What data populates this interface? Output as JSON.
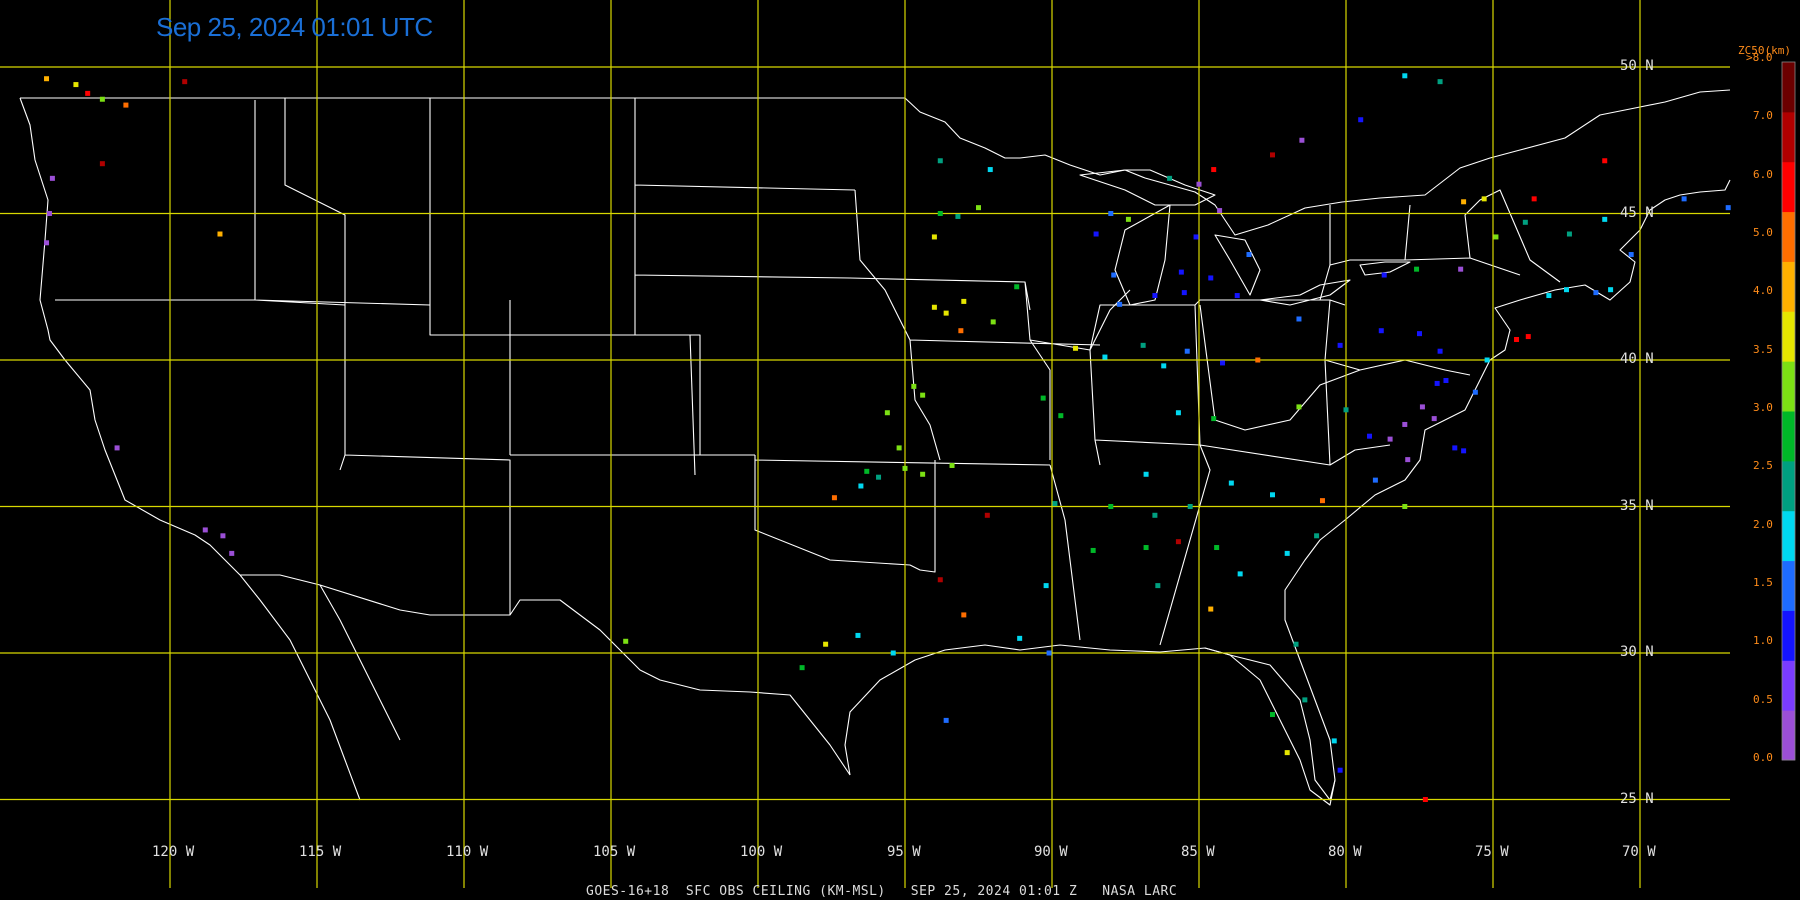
{
  "header": {
    "timestamp": "Sep 25, 2024 01:01 UTC"
  },
  "footer": {
    "caption": "GOES-16+18  SFC OBS CEILING (KM-MSL)   SEP 25, 2024 01:01 Z   NASA LARC"
  },
  "latitudes": [
    {
      "label": "50 N",
      "value": 50
    },
    {
      "label": "45 N",
      "value": 45
    },
    {
      "label": "40 N",
      "value": 40
    },
    {
      "label": "35 N",
      "value": 35
    },
    {
      "label": "30 N",
      "value": 30
    },
    {
      "label": "25 N",
      "value": 25
    }
  ],
  "longitudes": [
    {
      "label": "120 W",
      "value": -120
    },
    {
      "label": "115 W",
      "value": -115
    },
    {
      "label": "110 W",
      "value": -110
    },
    {
      "label": "105 W",
      "value": -105
    },
    {
      "label": "100 W",
      "value": -100
    },
    {
      "label": "95 W",
      "value": -95
    },
    {
      "label": "90 W",
      "value": -90
    },
    {
      "label": "85 W",
      "value": -85
    },
    {
      "label": "80 W",
      "value": -80
    },
    {
      "label": "75 W",
      "value": -75
    },
    {
      "label": "70 W",
      "value": -70
    }
  ],
  "legend": {
    "title": "ZC50(km)",
    "ticks": [
      ">8.0",
      "7.0",
      "6.0",
      "5.0",
      "4.0",
      "3.5",
      "3.0",
      "2.5",
      "2.0",
      "1.5",
      "1.0",
      "0.5",
      "0.0"
    ],
    "colors": [
      "#9b4fd6",
      "#7a3cff",
      "#1414ff",
      "#1e6cff",
      "#00d8f0",
      "#00a080",
      "#00b828",
      "#7ce014",
      "#e6e600",
      "#ffb000",
      "#ff6e00",
      "#ff0000",
      "#b00000",
      "#6b0000"
    ]
  },
  "colors": {
    "grid": "#d8d800",
    "boundary": "#ffffff"
  },
  "observations": [
    {
      "lon": -122.8,
      "lat": 49.1,
      "c": "#ff0000"
    },
    {
      "lon": -123.2,
      "lat": 49.4,
      "c": "#e6e600"
    },
    {
      "lon": -122.3,
      "lat": 48.9,
      "c": "#7ce014"
    },
    {
      "lon": -121.5,
      "lat": 48.7,
      "c": "#ff6e00"
    },
    {
      "lon": -119.5,
      "lat": 49.5,
      "c": "#b00000"
    },
    {
      "lon": -124.2,
      "lat": 49.6,
      "c": "#ffb000"
    },
    {
      "lon": -124.0,
      "lat": 46.2,
      "c": "#9b4fd6"
    },
    {
      "lon": -124.1,
      "lat": 45.0,
      "c": "#9b4fd6"
    },
    {
      "lon": -124.2,
      "lat": 44.0,
      "c": "#9b4fd6"
    },
    {
      "lon": -122.3,
      "lat": 46.7,
      "c": "#b00000"
    },
    {
      "lon": -118.3,
      "lat": 44.3,
      "c": "#ffb000"
    },
    {
      "lon": -121.8,
      "lat": 37.0,
      "c": "#9b4fd6"
    },
    {
      "lon": -118.8,
      "lat": 34.2,
      "c": "#9b4fd6"
    },
    {
      "lon": -118.2,
      "lat": 34.0,
      "c": "#9b4fd6"
    },
    {
      "lon": -117.9,
      "lat": 33.4,
      "c": "#9b4fd6"
    },
    {
      "lon": -93.8,
      "lat": 45.0,
      "c": "#00b828"
    },
    {
      "lon": -93.2,
      "lat": 44.9,
      "c": "#00a080"
    },
    {
      "lon": -92.5,
      "lat": 45.2,
      "c": "#7ce014"
    },
    {
      "lon": -93.8,
      "lat": 46.8,
      "c": "#00a080"
    },
    {
      "lon": -92.1,
      "lat": 46.5,
      "c": "#00d8f0"
    },
    {
      "lon": -94.0,
      "lat": 44.2,
      "c": "#e6e600"
    },
    {
      "lon": -93.6,
      "lat": 41.6,
      "c": "#e6e600"
    },
    {
      "lon": -93.0,
      "lat": 42.0,
      "c": "#e6e600"
    },
    {
      "lon": -92.0,
      "lat": 41.3,
      "c": "#7ce014"
    },
    {
      "lon": -91.2,
      "lat": 42.5,
      "c": "#00b828"
    },
    {
      "lon": -93.1,
      "lat": 41.0,
      "c": "#ff6e00"
    },
    {
      "lon": -94.0,
      "lat": 41.8,
      "c": "#e6e600"
    },
    {
      "lon": -94.7,
      "lat": 39.1,
      "c": "#7ce014"
    },
    {
      "lon": -94.4,
      "lat": 38.8,
      "c": "#7ce014"
    },
    {
      "lon": -95.6,
      "lat": 38.2,
      "c": "#7ce014"
    },
    {
      "lon": -95.2,
      "lat": 37.0,
      "c": "#7ce014"
    },
    {
      "lon": -96.3,
      "lat": 36.2,
      "c": "#00b828"
    },
    {
      "lon": -94.4,
      "lat": 36.1,
      "c": "#7ce014"
    },
    {
      "lon": -97.4,
      "lat": 35.3,
      "c": "#ff6e00"
    },
    {
      "lon": -96.5,
      "lat": 35.7,
      "c": "#00d8f0"
    },
    {
      "lon": -95.9,
      "lat": 36.0,
      "c": "#00a080"
    },
    {
      "lon": -95.0,
      "lat": 36.3,
      "c": "#7ce014"
    },
    {
      "lon": -93.4,
      "lat": 36.4,
      "c": "#7ce014"
    },
    {
      "lon": -90.3,
      "lat": 38.7,
      "c": "#00b828"
    },
    {
      "lon": -89.7,
      "lat": 38.1,
      "c": "#00b828"
    },
    {
      "lon": -89.2,
      "lat": 40.4,
      "c": "#e6e600"
    },
    {
      "lon": -88.2,
      "lat": 40.1,
      "c": "#00d8f0"
    },
    {
      "lon": -87.7,
      "lat": 41.9,
      "c": "#1e6cff"
    },
    {
      "lon": -87.9,
      "lat": 42.9,
      "c": "#1e6cff"
    },
    {
      "lon": -88.5,
      "lat": 44.3,
      "c": "#1414ff"
    },
    {
      "lon": -87.4,
      "lat": 44.8,
      "c": "#7ce014"
    },
    {
      "lon": -86.5,
      "lat": 42.2,
      "c": "#1414ff"
    },
    {
      "lon": -85.5,
      "lat": 42.3,
      "c": "#1414ff"
    },
    {
      "lon": -84.6,
      "lat": 42.8,
      "c": "#1414ff"
    },
    {
      "lon": -83.7,
      "lat": 42.2,
      "c": "#1414ff"
    },
    {
      "lon": -84.3,
      "lat": 45.1,
      "c": "#9b4fd6"
    },
    {
      "lon": -85.1,
      "lat": 44.2,
      "c": "#1414ff"
    },
    {
      "lon": -85.6,
      "lat": 43.0,
      "c": "#1414ff"
    },
    {
      "lon": -83.3,
      "lat": 43.6,
      "c": "#1e6cff"
    },
    {
      "lon": -86.2,
      "lat": 39.8,
      "c": "#00d8f0"
    },
    {
      "lon": -85.4,
      "lat": 40.3,
      "c": "#1e6cff"
    },
    {
      "lon": -86.9,
      "lat": 40.5,
      "c": "#00a080"
    },
    {
      "lon": -84.2,
      "lat": 39.9,
      "c": "#1414ff"
    },
    {
      "lon": -83.0,
      "lat": 40.0,
      "c": "#ff6e00"
    },
    {
      "lon": -81.6,
      "lat": 41.4,
      "c": "#1e6cff"
    },
    {
      "lon": -80.2,
      "lat": 40.5,
      "c": "#1414ff"
    },
    {
      "lon": -78.8,
      "lat": 41.0,
      "c": "#1414ff"
    },
    {
      "lon": -77.5,
      "lat": 40.9,
      "c": "#1414ff"
    },
    {
      "lon": -76.8,
      "lat": 40.3,
      "c": "#1414ff"
    },
    {
      "lon": -75.2,
      "lat": 40.0,
      "c": "#00d8f0"
    },
    {
      "lon": -74.2,
      "lat": 40.7,
      "c": "#ff0000"
    },
    {
      "lon": -73.8,
      "lat": 40.8,
      "c": "#ff0000"
    },
    {
      "lon": -73.1,
      "lat": 42.2,
      "c": "#00d8f0"
    },
    {
      "lon": -72.5,
      "lat": 42.4,
      "c": "#00d8f0"
    },
    {
      "lon": -71.5,
      "lat": 42.3,
      "c": "#1e6cff"
    },
    {
      "lon": -71.0,
      "lat": 42.4,
      "c": "#00d8f0"
    },
    {
      "lon": -70.3,
      "lat": 43.6,
      "c": "#1e6cff"
    },
    {
      "lon": -71.2,
      "lat": 44.8,
      "c": "#00d8f0"
    },
    {
      "lon": -72.4,
      "lat": 44.3,
      "c": "#00a080"
    },
    {
      "lon": -73.9,
      "lat": 44.7,
      "c": "#00a080"
    },
    {
      "lon": -74.9,
      "lat": 44.2,
      "c": "#7ce014"
    },
    {
      "lon": -76.1,
      "lat": 43.1,
      "c": "#9b4fd6"
    },
    {
      "lon": -77.6,
      "lat": 43.1,
      "c": "#00b828"
    },
    {
      "lon": -78.7,
      "lat": 42.9,
      "c": "#1414ff"
    },
    {
      "lon": -77.4,
      "lat": 38.4,
      "c": "#9b4fd6"
    },
    {
      "lon": -77.0,
      "lat": 38.0,
      "c": "#9b4fd6"
    },
    {
      "lon": -78.0,
      "lat": 37.8,
      "c": "#9b4fd6"
    },
    {
      "lon": -78.5,
      "lat": 37.3,
      "c": "#9b4fd6"
    },
    {
      "lon": -79.2,
      "lat": 37.4,
      "c": "#1414ff"
    },
    {
      "lon": -76.3,
      "lat": 37.0,
      "c": "#1414ff"
    },
    {
      "lon": -76.0,
      "lat": 36.9,
      "c": "#1414ff"
    },
    {
      "lon": -77.9,
      "lat": 36.6,
      "c": "#9b4fd6"
    },
    {
      "lon": -76.9,
      "lat": 39.2,
      "c": "#1414ff"
    },
    {
      "lon": -76.6,
      "lat": 39.3,
      "c": "#1414ff"
    },
    {
      "lon": -75.6,
      "lat": 38.9,
      "c": "#1e6cff"
    },
    {
      "lon": -80.0,
      "lat": 38.3,
      "c": "#00a080"
    },
    {
      "lon": -81.6,
      "lat": 38.4,
      "c": "#7ce014"
    },
    {
      "lon": -84.5,
      "lat": 38.0,
      "c": "#00b828"
    },
    {
      "lon": -85.7,
      "lat": 38.2,
      "c": "#00d8f0"
    },
    {
      "lon": -86.8,
      "lat": 36.1,
      "c": "#00d8f0"
    },
    {
      "lon": -85.3,
      "lat": 35.0,
      "c": "#00a080"
    },
    {
      "lon": -83.9,
      "lat": 35.8,
      "c": "#00d8f0"
    },
    {
      "lon": -82.5,
      "lat": 35.4,
      "c": "#00d8f0"
    },
    {
      "lon": -80.8,
      "lat": 35.2,
      "c": "#ff6e00"
    },
    {
      "lon": -79.0,
      "lat": 35.9,
      "c": "#1e6cff"
    },
    {
      "lon": -78.0,
      "lat": 35.0,
      "c": "#7ce014"
    },
    {
      "lon": -88.0,
      "lat": 35.0,
      "c": "#00b828"
    },
    {
      "lon": -89.9,
      "lat": 35.1,
      "c": "#00a080"
    },
    {
      "lon": -90.2,
      "lat": 32.3,
      "c": "#00d8f0"
    },
    {
      "lon": -88.6,
      "lat": 33.5,
      "c": "#00b828"
    },
    {
      "lon": -86.8,
      "lat": 33.6,
      "c": "#00b828"
    },
    {
      "lon": -86.4,
      "lat": 32.3,
      "c": "#00a080"
    },
    {
      "lon": -84.4,
      "lat": 33.6,
      "c": "#00b828"
    },
    {
      "lon": -83.6,
      "lat": 32.7,
      "c": "#00d8f0"
    },
    {
      "lon": -84.6,
      "lat": 31.5,
      "c": "#ffb000"
    },
    {
      "lon": -85.7,
      "lat": 33.8,
      "c": "#b00000"
    },
    {
      "lon": -86.5,
      "lat": 34.7,
      "c": "#00a080"
    },
    {
      "lon": -82.0,
      "lat": 33.4,
      "c": "#00d8f0"
    },
    {
      "lon": -81.0,
      "lat": 34.0,
      "c": "#00a080"
    },
    {
      "lon": -92.2,
      "lat": 34.7,
      "c": "#b00000"
    },
    {
      "lon": -93.8,
      "lat": 32.5,
      "c": "#b00000"
    },
    {
      "lon": -93.0,
      "lat": 31.3,
      "c": "#ff6e00"
    },
    {
      "lon": -91.1,
      "lat": 30.5,
      "c": "#00d8f0"
    },
    {
      "lon": -90.1,
      "lat": 30.0,
      "c": "#1e6cff"
    },
    {
      "lon": -95.4,
      "lat": 30.0,
      "c": "#00d8f0"
    },
    {
      "lon": -97.7,
      "lat": 30.3,
      "c": "#e6e600"
    },
    {
      "lon": -96.6,
      "lat": 30.6,
      "c": "#00d8f0"
    },
    {
      "lon": -98.5,
      "lat": 29.5,
      "c": "#00b828"
    },
    {
      "lon": -104.5,
      "lat": 30.4,
      "c": "#7ce014"
    },
    {
      "lon": -93.6,
      "lat": 27.7,
      "c": "#1e6cff"
    },
    {
      "lon": -82.0,
      "lat": 26.6,
      "c": "#e6e600"
    },
    {
      "lon": -80.2,
      "lat": 26.0,
      "c": "#1414ff"
    },
    {
      "lon": -80.4,
      "lat": 27.0,
      "c": "#00d8f0"
    },
    {
      "lon": -81.4,
      "lat": 28.4,
      "c": "#00a080"
    },
    {
      "lon": -82.5,
      "lat": 27.9,
      "c": "#00b828"
    },
    {
      "lon": -81.7,
      "lat": 30.3,
      "c": "#00a080"
    },
    {
      "lon": -77.3,
      "lat": 25.0,
      "c": "#ff0000"
    },
    {
      "lon": -81.5,
      "lat": 47.5,
      "c": "#9b4fd6"
    },
    {
      "lon": -79.5,
      "lat": 48.2,
      "c": "#1414ff"
    },
    {
      "lon": -78.0,
      "lat": 49.7,
      "c": "#00d8f0"
    },
    {
      "lon": -76.8,
      "lat": 49.5,
      "c": "#00a080"
    },
    {
      "lon": -76.0,
      "lat": 45.4,
      "c": "#ffb000"
    },
    {
      "lon": -75.3,
      "lat": 45.5,
      "c": "#e6e600"
    },
    {
      "lon": -73.6,
      "lat": 45.5,
      "c": "#ff0000"
    },
    {
      "lon": -71.2,
      "lat": 46.8,
      "c": "#ff0000"
    },
    {
      "lon": -68.5,
      "lat": 45.5,
      "c": "#1e6cff"
    },
    {
      "lon": -67.0,
      "lat": 45.2,
      "c": "#1e6cff"
    },
    {
      "lon": -82.5,
      "lat": 47.0,
      "c": "#b00000"
    },
    {
      "lon": -84.5,
      "lat": 46.5,
      "c": "#ff0000"
    },
    {
      "lon": -85.0,
      "lat": 46.0,
      "c": "#9b4fd6"
    },
    {
      "lon": -86.0,
      "lat": 46.2,
      "c": "#00a080"
    },
    {
      "lon": -88.0,
      "lat": 45.0,
      "c": "#1e6cff"
    }
  ]
}
